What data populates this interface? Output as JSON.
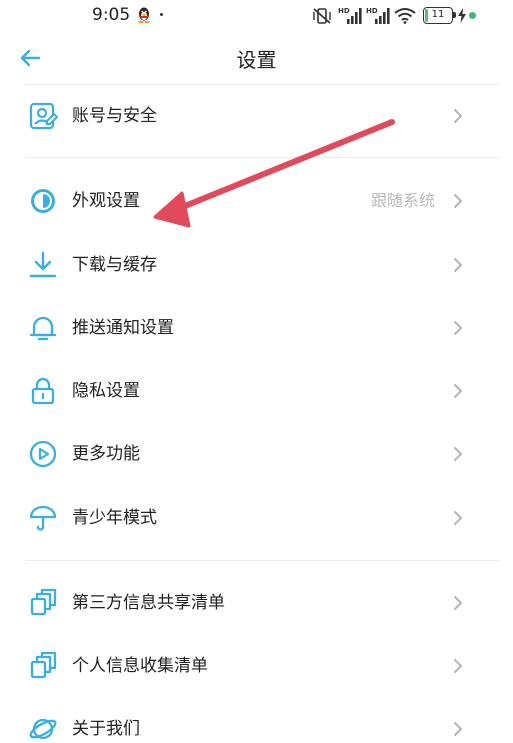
{
  "status_bar": {
    "time": "9:05",
    "signal_badge": "HD",
    "battery_level": "11",
    "battery_fraction": 0.11
  },
  "header": {
    "title": "设置",
    "back_icon": "arrow-left-icon"
  },
  "groups": [
    {
      "items": [
        {
          "key": "account",
          "label": "账号与安全",
          "icon": "account-security-icon"
        }
      ]
    },
    {
      "items": [
        {
          "key": "appearance",
          "label": "外观设置",
          "value": "跟随系统",
          "icon": "appearance-icon"
        },
        {
          "key": "download",
          "label": "下载与缓存",
          "icon": "download-icon"
        },
        {
          "key": "notification",
          "label": "推送通知设置",
          "icon": "bell-icon"
        },
        {
          "key": "privacy",
          "label": "隐私设置",
          "icon": "lock-icon"
        },
        {
          "key": "more",
          "label": "更多功能",
          "icon": "play-circle-icon"
        },
        {
          "key": "teen",
          "label": "青少年模式",
          "icon": "umbrella-icon"
        }
      ]
    },
    {
      "items": [
        {
          "key": "third_party",
          "label": "第三方信息共享清单",
          "icon": "copy-icon"
        },
        {
          "key": "personal_info",
          "label": "个人信息收集清单",
          "icon": "copy-icon"
        },
        {
          "key": "about",
          "label": "关于我们",
          "icon": "planet-icon"
        }
      ]
    }
  ],
  "colors": {
    "accent": "#3aaee0",
    "annotation_arrow": "#e04a5a",
    "divider": "#ececec",
    "muted_text": "#b9b9b9",
    "chevron": "#b5b5b5"
  }
}
